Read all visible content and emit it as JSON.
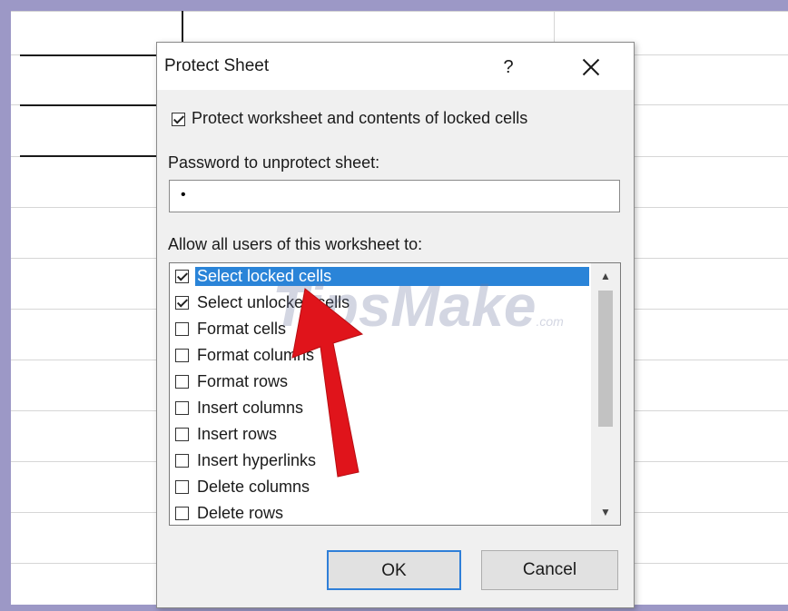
{
  "dialog": {
    "title": "Protect Sheet",
    "help_label": "?",
    "protect_label": "Protect worksheet and contents of locked cells",
    "protect_checked": true,
    "password_label": "Password to unprotect sheet:",
    "password_value": "•",
    "allow_label": "Allow all users of this worksheet to:",
    "permissions": [
      {
        "label": "Select locked cells",
        "checked": true,
        "selected": true
      },
      {
        "label": "Select unlocked cells",
        "checked": true,
        "selected": false
      },
      {
        "label": "Format cells",
        "checked": false,
        "selected": false
      },
      {
        "label": "Format columns",
        "checked": false,
        "selected": false
      },
      {
        "label": "Format rows",
        "checked": false,
        "selected": false
      },
      {
        "label": "Insert columns",
        "checked": false,
        "selected": false
      },
      {
        "label": "Insert rows",
        "checked": false,
        "selected": false
      },
      {
        "label": "Insert hyperlinks",
        "checked": false,
        "selected": false
      },
      {
        "label": "Delete columns",
        "checked": false,
        "selected": false
      },
      {
        "label": "Delete rows",
        "checked": false,
        "selected": false
      }
    ],
    "ok_label": "OK",
    "cancel_label": "Cancel"
  },
  "watermark": {
    "text": "TipsMake",
    "suffix": ".com"
  },
  "colors": {
    "selection": "#2a84d8",
    "arrow": "#e0141b",
    "frame": "#9c98c6"
  }
}
